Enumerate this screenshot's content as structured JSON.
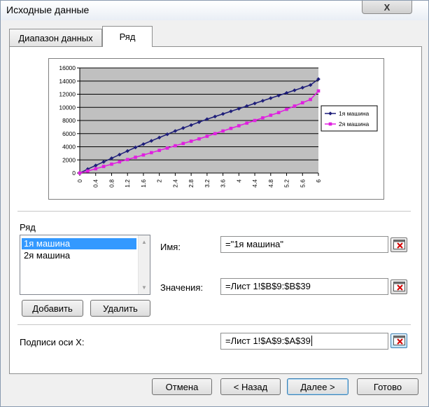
{
  "window": {
    "title": "Исходные данные",
    "close_glyph": "X"
  },
  "tabs": [
    {
      "label": "Диапазон данных",
      "active": false
    },
    {
      "label": "Ряд",
      "active": true
    }
  ],
  "chart_data": {
    "type": "line",
    "x": [
      "0",
      "0.4",
      "0.8",
      "1.2",
      "1.6",
      "2",
      "2.4",
      "2.8",
      "3.2",
      "3.6",
      "4",
      "4.4",
      "4.8",
      "5.2",
      "5.6",
      "6"
    ],
    "x_values": [
      0,
      0.2,
      0.4,
      0.6,
      0.8,
      1.0,
      1.2,
      1.4,
      1.6,
      1.8,
      2.0,
      2.2,
      2.4,
      2.6,
      2.8,
      3.0,
      3.2,
      3.4,
      3.6,
      3.8,
      4.0,
      4.2,
      4.4,
      4.6,
      4.8,
      5.0,
      5.2,
      5.4,
      5.6,
      5.8,
      6.0
    ],
    "series": [
      {
        "name": "1я машина",
        "color": "#1f1f7a",
        "marker": "diamond",
        "values": [
          0,
          600,
          1150,
          1700,
          2250,
          2800,
          3350,
          3900,
          4400,
          4900,
          5400,
          5900,
          6400,
          6850,
          7300,
          7750,
          8200,
          8600,
          9000,
          9400,
          9800,
          10200,
          10600,
          11000,
          11400,
          11800,
          12200,
          12600,
          13000,
          13400,
          14300
        ]
      },
      {
        "name": "2я машина",
        "color": "#e020e0",
        "marker": "square",
        "values": [
          0,
          300,
          650,
          1000,
          1350,
          1700,
          2050,
          2400,
          2750,
          3100,
          3450,
          3800,
          4150,
          4500,
          4850,
          5200,
          5600,
          6000,
          6400,
          6800,
          7200,
          7600,
          8000,
          8400,
          8800,
          9200,
          9700,
          10200,
          10700,
          11200,
          12500
        ]
      }
    ],
    "yticks": [
      "0",
      "2000",
      "4000",
      "6000",
      "8000",
      "10000",
      "12000",
      "14000",
      "16000"
    ],
    "ylim": [
      0,
      16000
    ],
    "xlim": [
      0,
      6
    ],
    "grid": true,
    "plot_background": "#c0c0c0",
    "legend": "right"
  },
  "series_section": {
    "label": "Ряд",
    "items": [
      "1я машина",
      "2я машина"
    ],
    "selected_index": 0,
    "add_label": "Добавить",
    "remove_label": "Удалить"
  },
  "fields": {
    "name_label": "Имя:",
    "name_value": "=\"1я машина\"",
    "values_label": "Значения:",
    "values_value": "=Лист 1!$B$9:$B$39",
    "xaxis_label": "Подписи оси X:",
    "xaxis_value": "=Лист 1!$A$9:$A$39"
  },
  "footer": {
    "cancel": "Отмена",
    "back": "< Назад",
    "next": "Далее >",
    "finish": "Готово"
  }
}
